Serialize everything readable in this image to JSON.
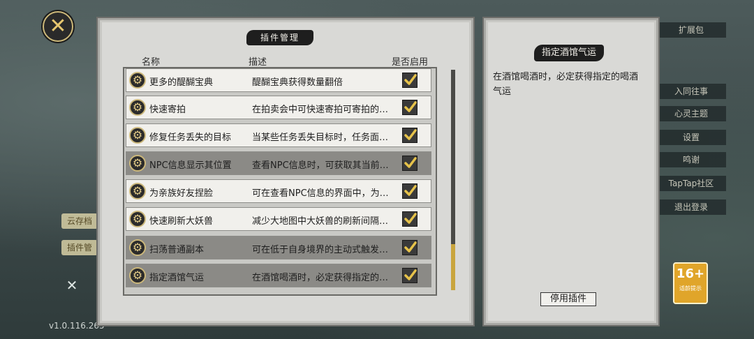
{
  "dialog": {
    "title": "插件管理",
    "close_icon": "close-icon"
  },
  "columns": {
    "name": "名称",
    "desc": "描述",
    "enabled": "是否启用"
  },
  "plugins": [
    {
      "name": "更多的醍醐宝典",
      "desc": "醍醐宝典获得数量翻倍",
      "enabled": true,
      "selected": false
    },
    {
      "name": "快速寄拍",
      "desc": "在拍卖会中可快速寄拍可寄拍的…",
      "enabled": true,
      "selected": false
    },
    {
      "name": "修复任务丢失的目标",
      "desc": "当某些任务丢失目标时，任务面…",
      "enabled": true,
      "selected": false
    },
    {
      "name": "NPC信息显示其位置",
      "desc": "查看NPC信息时，可获取其当前…",
      "enabled": true,
      "selected": true
    },
    {
      "name": "为亲族好友捏脸",
      "desc": "可在查看NPC信息的界面中，为…",
      "enabled": true,
      "selected": false
    },
    {
      "name": "快速刷新大妖兽",
      "desc": "减少大地图中大妖兽的刷新间隔…",
      "enabled": true,
      "selected": false
    },
    {
      "name": "扫荡普通副本",
      "desc": "可在低于自身境界的主动式触发…",
      "enabled": true,
      "selected": true
    },
    {
      "name": "指定酒馆气运",
      "desc": "在酒馆喝酒时，必定获得指定的…",
      "enabled": true,
      "selected": true
    }
  ],
  "detail": {
    "title": "指定酒馆气运",
    "description": "在酒馆喝酒时，必定获得指定的喝酒气运",
    "disable_button": "停用插件"
  },
  "background": {
    "version": "v1.0.116.265",
    "left_tags": [
      "云存档",
      "插件管"
    ],
    "right_menu": [
      "扩展包",
      "入同往事",
      "心灵主题",
      "设置",
      "鸣谢",
      "TapTap社区",
      "退出登录"
    ],
    "age_rating": "16+",
    "age_rating_sub": "适龄提示"
  },
  "colors": {
    "accent_gold": "#c9a53e",
    "banner_dark": "#1e1e1e",
    "row_selected": "#8b8a86"
  }
}
